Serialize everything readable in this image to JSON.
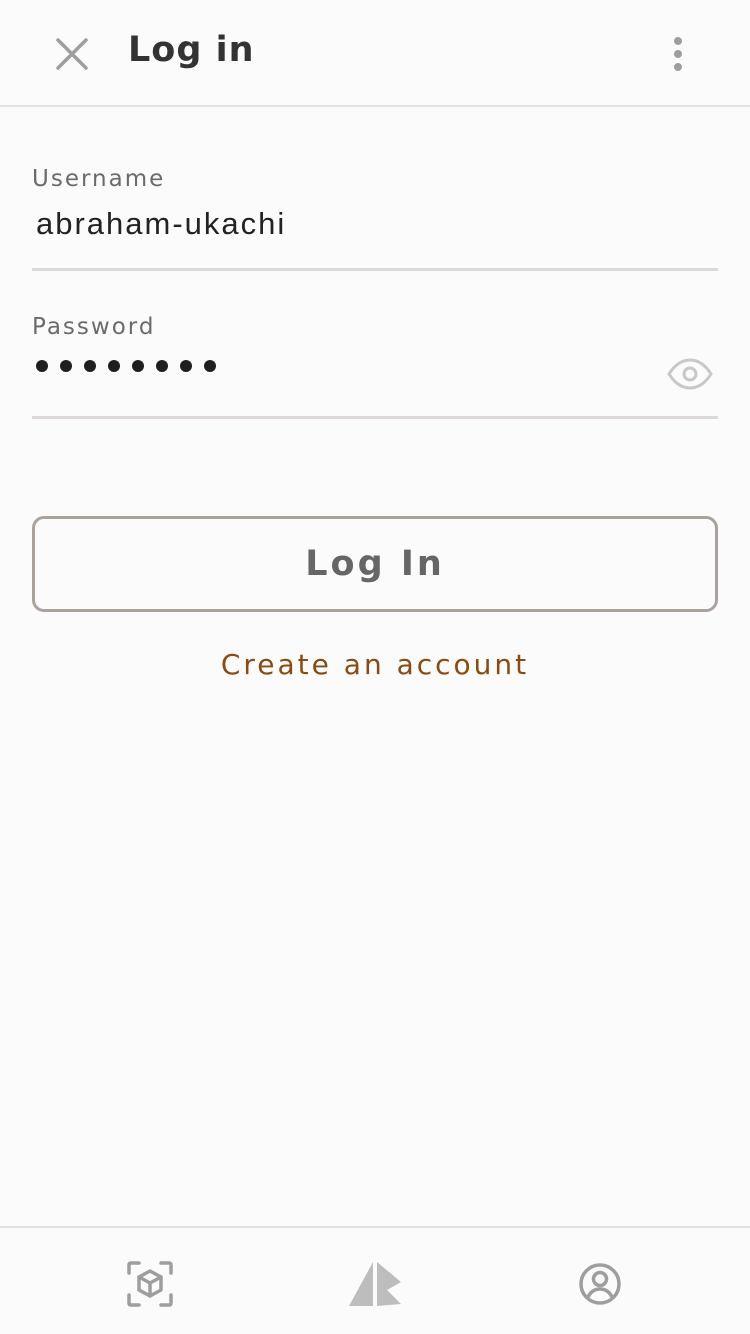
{
  "header": {
    "title": "Log in",
    "close_icon": "close-icon",
    "more_icon": "more-vertical-icon"
  },
  "form": {
    "username": {
      "label": "Username",
      "value": "abraham-ukachi"
    },
    "password": {
      "label": "Password",
      "masked_length": 8,
      "toggle_icon": "eye-icon"
    },
    "login_button": "Log In",
    "create_account_link": "Create an account"
  },
  "bottom_nav": {
    "items": [
      {
        "name": "ar-scan",
        "icon": "cube-scan-icon"
      },
      {
        "name": "brand",
        "icon": "logo-icon"
      },
      {
        "name": "account",
        "icon": "account-circle-icon"
      }
    ]
  },
  "colors": {
    "background": "#fbfbfb",
    "accent_link": "#8a4b12",
    "button_border": "#a9a39c",
    "icon_gray": "#9e9e9e"
  }
}
